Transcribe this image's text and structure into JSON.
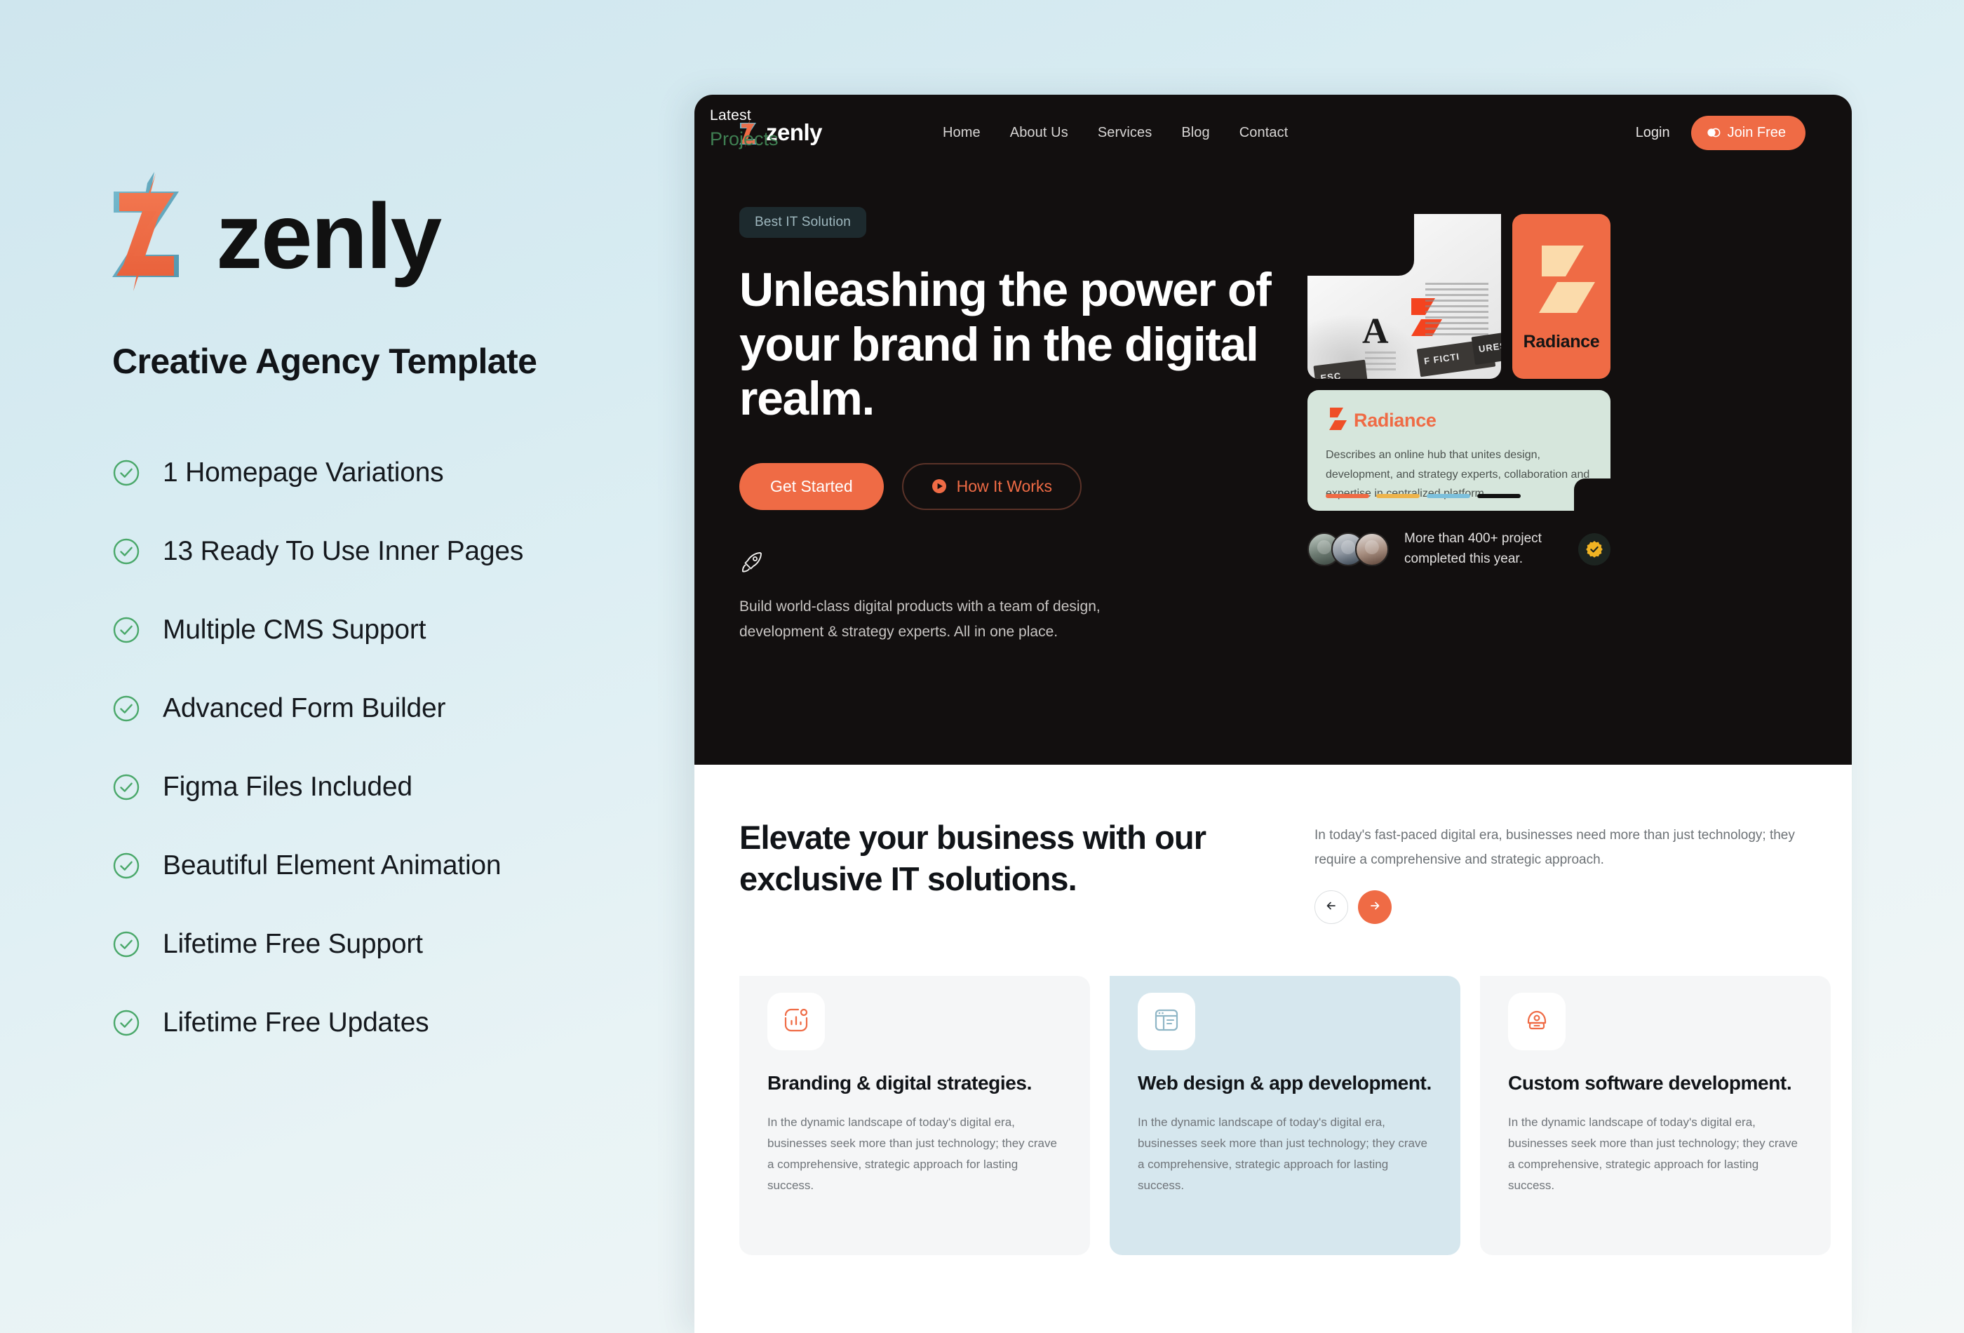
{
  "brand": {
    "name": "zenly",
    "tagline": "Creative Agency Template"
  },
  "features": [
    {
      "label": "1 Homepage Variations"
    },
    {
      "label": "13 Ready To Use Inner Pages"
    },
    {
      "label": "Multiple CMS Support"
    },
    {
      "label": "Advanced Form Builder"
    },
    {
      "label": "Figma Files Included"
    },
    {
      "label": "Beautiful Element Animation"
    },
    {
      "label": "Lifetime Free Support"
    },
    {
      "label": "Lifetime Free Updates"
    }
  ],
  "mockup": {
    "nav": {
      "logo": "zenly",
      "links": [
        "Home",
        "About Us",
        "Services",
        "Blog",
        "Contact"
      ],
      "login": "Login",
      "join": "Join Free"
    },
    "hero": {
      "badge": "Best IT Solution",
      "title": "Unleashing the power of your brand in the digital realm.",
      "cta_primary": "Get Started",
      "cta_secondary": "How It Works",
      "subtext": "Build world-class digital products with a team of design, development & strategy experts. All in one place.",
      "projects_label_top": "Latest",
      "projects_label_bottom": "Projects",
      "radiance_tile_title": "Radiance",
      "radiance_card": {
        "title": "Radiance",
        "text": "Describes an online hub that unites design, development, and strategy experts, collaboration and expertise in centralized platform.",
        "bar_colors": [
          "#ef6b45",
          "#eeb44c",
          "#7cc0dc",
          "#111111"
        ]
      },
      "stats": {
        "text": "More than 400+ project completed this year."
      }
    },
    "section": {
      "title": "Elevate your business with our exclusive IT solutions.",
      "paragraph": "In today's fast-paced digital era, businesses need more than just technology; they require a comprehensive and strategic approach.",
      "cards": [
        {
          "title": "Branding & digital strategies.",
          "text": "In the dynamic landscape of today's digital era, businesses seek more than just technology; they crave a comprehensive, strategic approach for lasting success.",
          "theme": "grey",
          "icon": "bar-chart-icon"
        },
        {
          "title": "Web design & app development.",
          "text": "In the dynamic landscape of today's digital era, businesses seek more than just technology; they crave a comprehensive, strategic approach for lasting success.",
          "theme": "blue",
          "icon": "layout-icon"
        },
        {
          "title": "Custom software development.",
          "text": "In the dynamic landscape of today's digital era, businesses seek more than just technology; they crave a comprehensive, strategic approach for lasting success.",
          "theme": "grey",
          "icon": "shield-user-icon"
        }
      ]
    }
  },
  "colors": {
    "accent": "#ef6b45",
    "dark": "#120f0f",
    "teal": "#61a8bd",
    "green_check": "#4aa86a",
    "page_bg": "#d6e9f0",
    "card_blue": "#d6e7ee",
    "mint": "#d6e6dc"
  }
}
